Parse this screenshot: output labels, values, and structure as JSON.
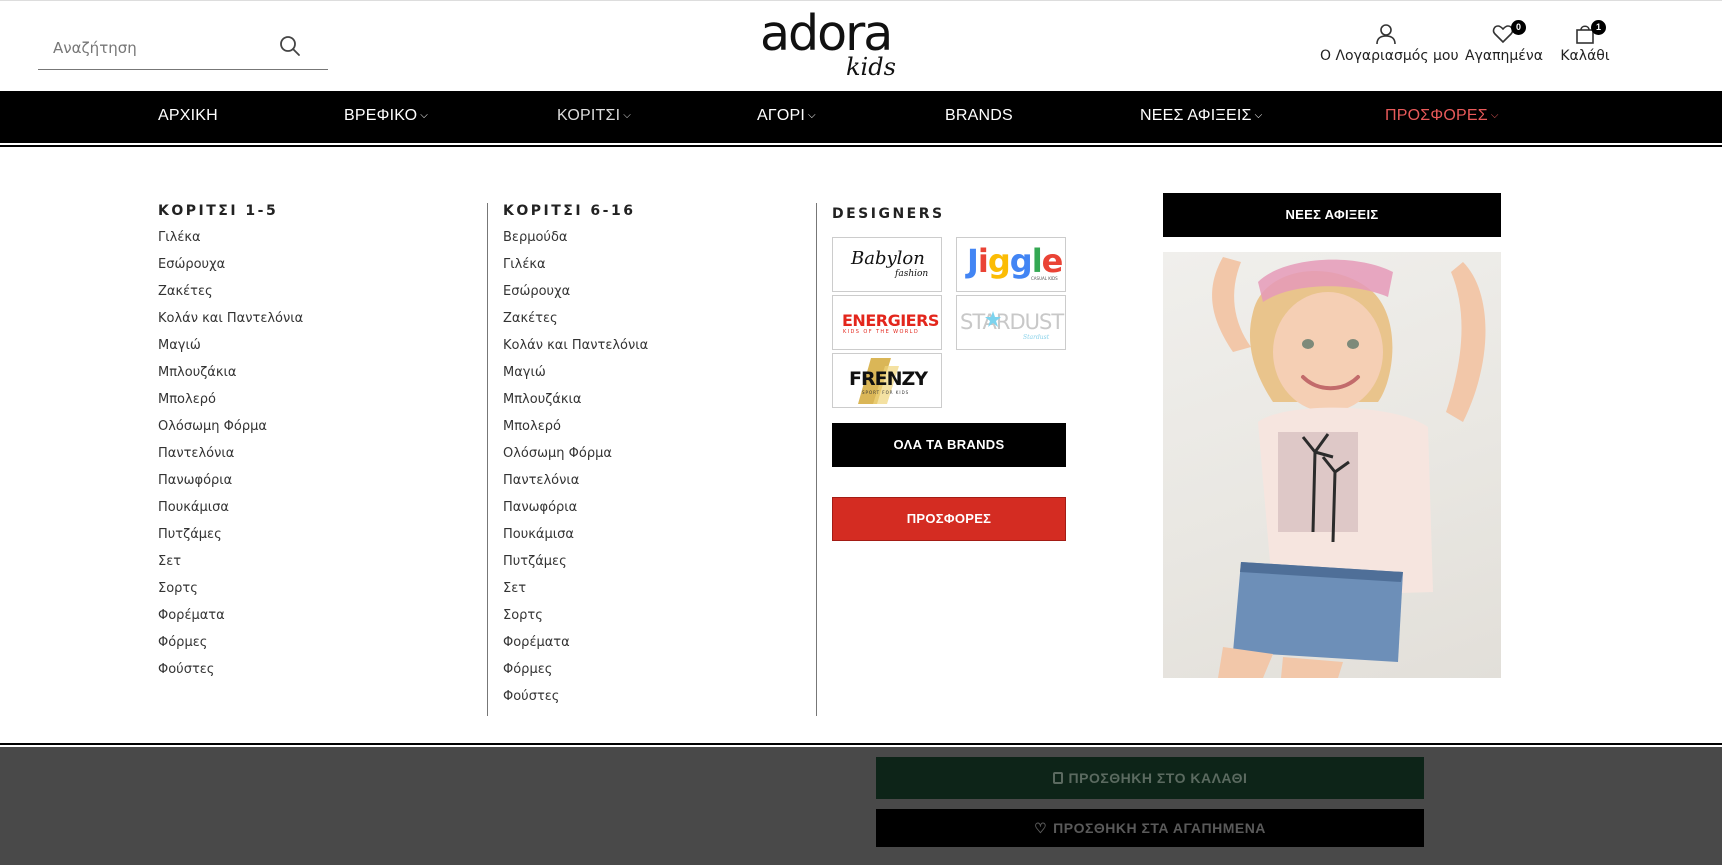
{
  "header": {
    "search_placeholder": "Αναζήτηση",
    "logo_main": "adora",
    "logo_sub": "kids",
    "account_label": "Ο Λογαριασμός μου",
    "favorites_label": "Αγαπημένα",
    "favorites_count": "0",
    "cart_label": "Καλάθι",
    "cart_count": "1"
  },
  "nav": {
    "items": [
      {
        "label": "ΑΡΧΙΚΗ"
      },
      {
        "label": "ΒΡΕΦΙΚΟ"
      },
      {
        "label": "ΚΟΡΙΤΣΙ"
      },
      {
        "label": "ΑΓΟΡΙ"
      },
      {
        "label": "BRANDS"
      },
      {
        "label": "ΝΕΕΣ ΑΦΙΞΕΙΣ"
      },
      {
        "label": "ΠΡΟΣΦΟΡΕΣ"
      }
    ]
  },
  "mega": {
    "col1": {
      "title": "ΚΟΡΙΤΣΙ 1-5",
      "items": [
        "Γιλέκα",
        "Εσώρουχα",
        "Ζακέτες",
        "Κολάν και Παντελόνια",
        "Μαγιώ",
        "Μπλουζάκια",
        "Μπολερό",
        "Ολόσωμη Φόρμα",
        "Παντελόνια",
        "Πανωφόρια",
        "Πουκάμισα",
        "Πυτζάμες",
        "Σετ",
        "Σορτς",
        "Φορέματα",
        "Φόρμες",
        "Φούστες"
      ]
    },
    "col2": {
      "title": "ΚΟΡΙΤΣΙ 6-16",
      "items": [
        "Βερμούδα",
        "Γιλέκα",
        "Εσώρουχα",
        "Ζακέτες",
        "Κολάν και Παντελόνια",
        "Μαγιώ",
        "Μπλουζάκια",
        "Μπολερό",
        "Ολόσωμη Φόρμα",
        "Παντελόνια",
        "Πανωφόρια",
        "Πουκάμισα",
        "Πυτζάμες",
        "Σετ",
        "Σορτς",
        "Φορέματα",
        "Φόρμες",
        "Φούστες"
      ]
    },
    "designers": {
      "title": "DESIGNERS",
      "brands": {
        "babylon": {
          "name": "Babylon",
          "sub": "fashion"
        },
        "jiggle": {
          "letters": [
            "J",
            "i",
            "g",
            "g",
            "l",
            "e"
          ],
          "sub": "CASUAL KIDS"
        },
        "energiers": {
          "name": "ENERGIERS",
          "sub": "KIDS OF THE WORLD"
        },
        "stardust": {
          "name": "STARDUST",
          "sub": "Stardust"
        },
        "frenzy": {
          "name": "FRENZY",
          "sub": "SPORT FOR KIDS"
        }
      },
      "all_brands_label": "ΟΛΑ ΤΑ BRANDS",
      "offers_label": "ΠΡΟΣΦΟΡΕΣ"
    },
    "promo": {
      "new_arrivals_label": "ΝΕΕΣ ΑΦΙΞΕΙΣ"
    }
  },
  "product_actions": {
    "add_to_cart": "ΠΡΟΣΘΗΚΗ ΣΤΟ ΚΑΛΑΘΙ",
    "add_to_favorites": "ΠΡΟΣΘΗΚΗ ΣΤΑ ΑΓΑΠΗΜΕΝΑ"
  },
  "colors": {
    "nav_bg": "#000000",
    "promo_nav": "#e85a5a",
    "offers_button": "#d42c22",
    "jiggle": [
      "#4285f4",
      "#ea4335",
      "#fbbc05",
      "#4285f4",
      "#34a853",
      "#ea4335"
    ]
  }
}
